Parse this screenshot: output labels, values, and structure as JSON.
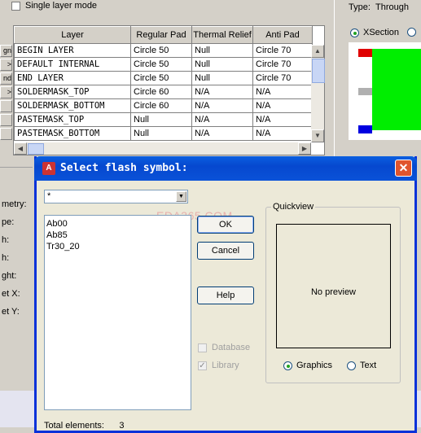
{
  "background": {
    "single_layer_mode_label": "Single layer mode",
    "type_label": "Type:",
    "type_value": "Through",
    "xsection_label": "XSection",
    "row_button_labels": [
      "gn",
      ">",
      "nd",
      ">",
      "",
      "",
      ""
    ],
    "grid": {
      "columns": [
        "Layer",
        "Regular Pad",
        "Thermal Relief",
        "Anti Pad"
      ],
      "rows": [
        [
          "BEGIN LAYER",
          "Circle 50",
          "Null",
          "Circle 70"
        ],
        [
          "DEFAULT INTERNAL",
          "Circle 50",
          "Null",
          "Circle 70"
        ],
        [
          "END LAYER",
          "Circle 50",
          "Null",
          "Circle 70"
        ],
        [
          "SOLDERMASK_TOP",
          "Circle 60",
          "N/A",
          "N/A"
        ],
        [
          "SOLDERMASK_BOTTOM",
          "Circle 60",
          "N/A",
          "N/A"
        ],
        [
          "PASTEMASK_TOP",
          "Null",
          "N/A",
          "N/A"
        ],
        [
          "PASTEMASK_BOTTOM",
          "Null",
          "N/A",
          "N/A"
        ]
      ]
    },
    "left_labels": [
      "metry:",
      "pe:",
      "h:",
      "h:",
      "ght:",
      "et X:",
      "et Y:"
    ],
    "colors": {
      "red": "#e00000",
      "green": "#00ee00",
      "blue": "#0000e0",
      "gray": "#b0b0b0"
    }
  },
  "dialog": {
    "title": "Select flash symbol:",
    "filter_value": "*",
    "symbols": [
      "Ab00",
      "Ab85",
      "Tr30_20"
    ],
    "ok_label": "OK",
    "cancel_label": "Cancel",
    "help_label": "Help",
    "database_label": "Database",
    "library_label": "Library",
    "quickview_label": "Quickview",
    "no_preview_text": "No preview",
    "graphics_label": "Graphics",
    "text_label": "Text",
    "total_elements_label": "Total elements:",
    "total_elements_value": "3",
    "watermark": "EDA365.COM"
  }
}
